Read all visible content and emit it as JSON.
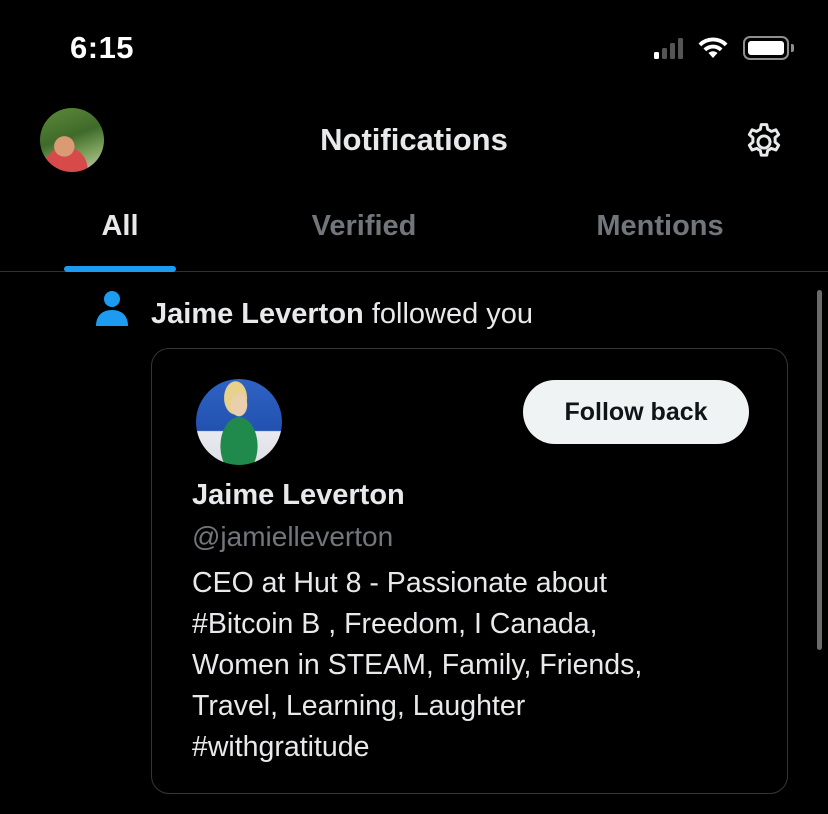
{
  "status_bar": {
    "time": "6:15",
    "icons": [
      "cellular-signal-icon",
      "wifi-icon",
      "battery-icon"
    ]
  },
  "header": {
    "title": "Notifications",
    "settings_icon": "gear-icon"
  },
  "tabs": [
    {
      "label": "All",
      "active": true
    },
    {
      "label": "Verified",
      "active": false
    },
    {
      "label": "Mentions",
      "active": false
    }
  ],
  "notification": {
    "icon": "person-icon",
    "actor": "Jaime Leverton",
    "action": " followed you",
    "profile": {
      "name": "Jaime Leverton",
      "handle": "@jamielleverton",
      "follow_button": "Follow back",
      "bio_lines": [
        "CEO at Hut 8 - Passionate about",
        "#Bitcoin B , Freedom, I Canada,",
        "Women in STEAM, Family, Friends,",
        "Travel, Learning, Laughter",
        "#withgratitude"
      ]
    }
  },
  "colors": {
    "background": "#000000",
    "accent": "#1d9bf0",
    "text_primary": "#e7e9ea",
    "text_secondary": "#71767b",
    "button_bg": "#eff3f4"
  }
}
